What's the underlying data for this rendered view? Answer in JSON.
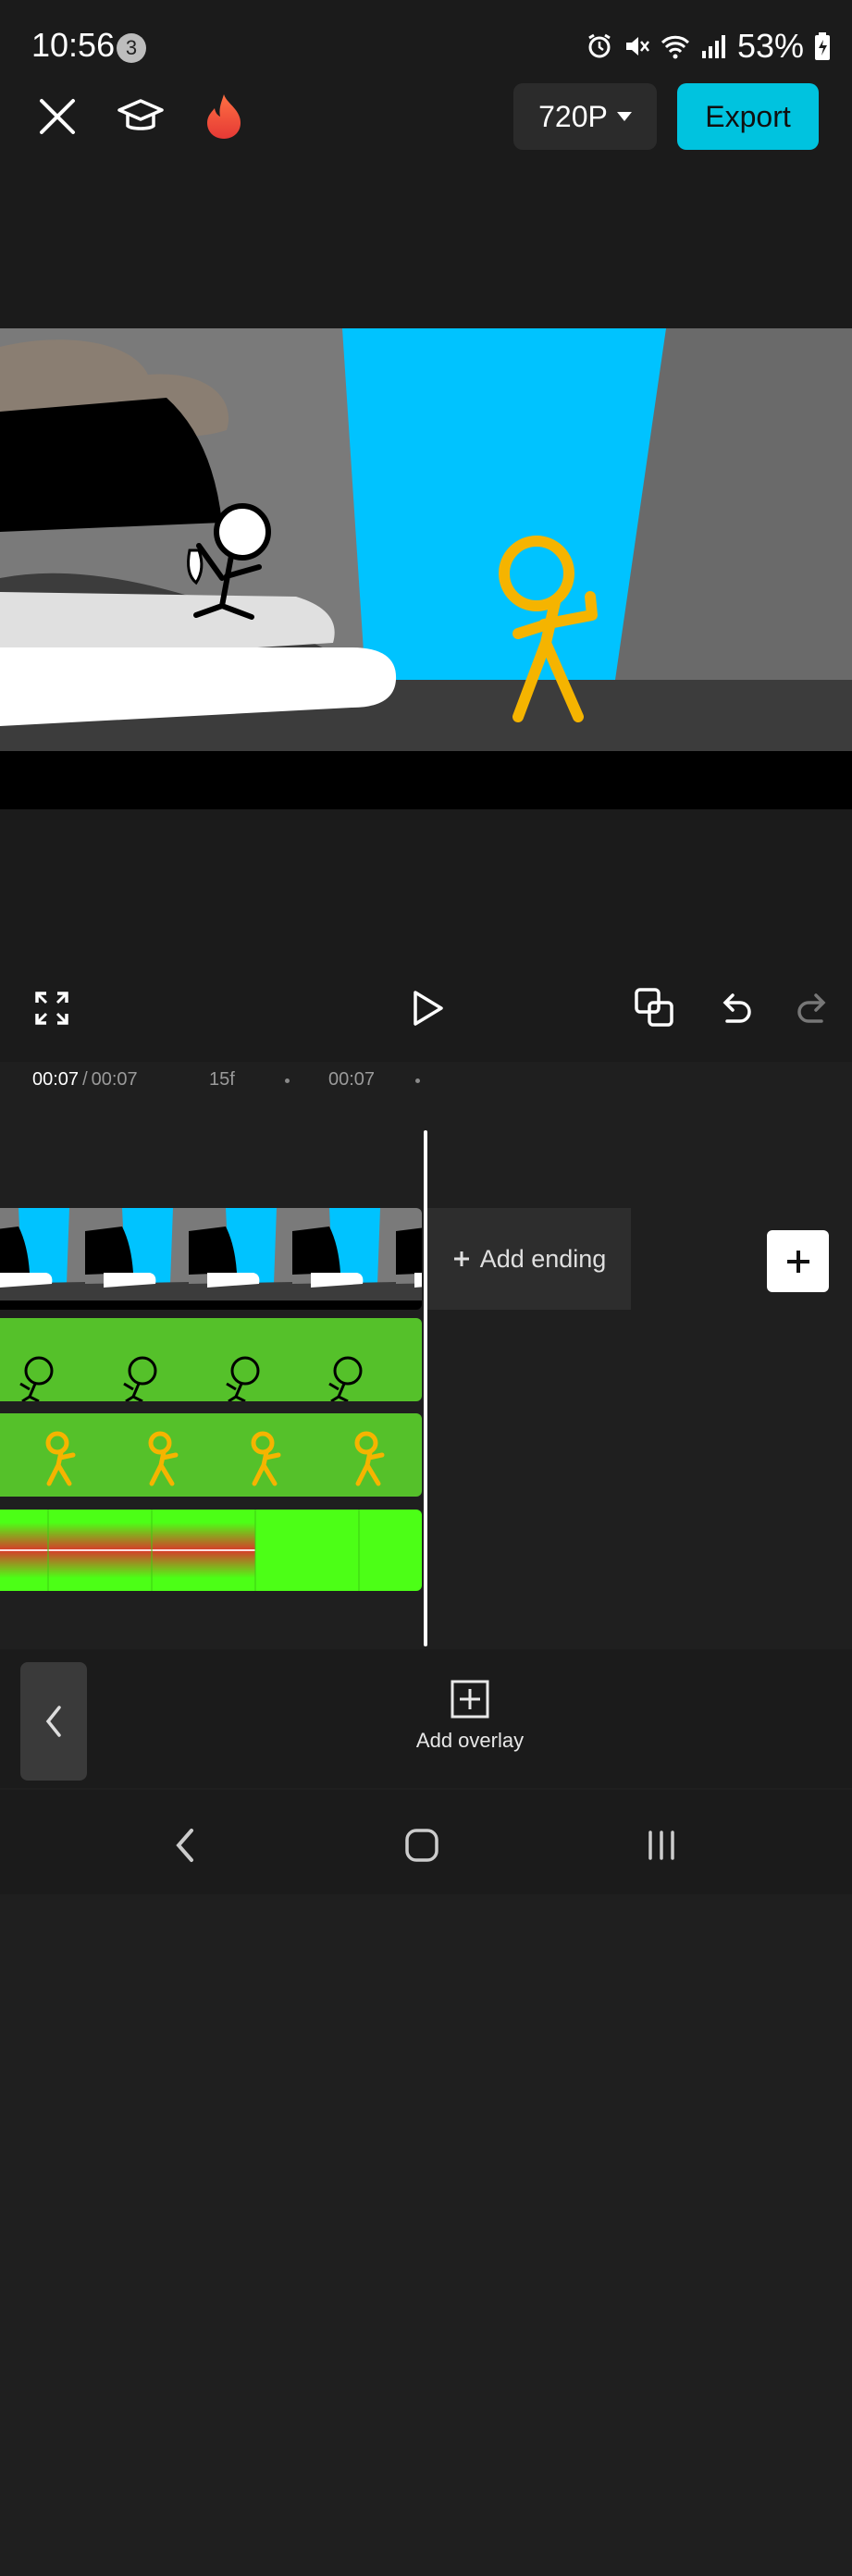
{
  "status_bar": {
    "time": "10:56",
    "notification_count": "3",
    "battery": "53%",
    "icons": [
      "alarm-icon",
      "mute-icon",
      "wifi-icon",
      "signal-icon",
      "battery-icon"
    ]
  },
  "toolbar": {
    "close_icon": "close-icon",
    "tutorial_icon": "graduation-cap-icon",
    "trending_icon": "flame-icon",
    "resolution": "720P",
    "export_label": "Export"
  },
  "player": {
    "fullscreen_icon": "fullscreen-icon",
    "play_icon": "play-icon",
    "keyframe_icon": "keyframe-icon",
    "undo_icon": "undo-icon",
    "redo_icon": "redo-icon"
  },
  "timeline": {
    "current_time": "00:07",
    "total_time": "00:07",
    "ruler": [
      "15f",
      "00:07"
    ],
    "add_ending_label": "Add ending",
    "tracks": [
      "main-video",
      "overlay-black-stickman",
      "overlay-orange-stickman",
      "overlay-green-screen"
    ]
  },
  "bottom_bar": {
    "add_overlay_label": "Add overlay"
  },
  "colors": {
    "accent": "#00c3df",
    "green_screen": "#55c12a",
    "sky": "#00c3ff",
    "stickman_orange": "#f5b400"
  }
}
